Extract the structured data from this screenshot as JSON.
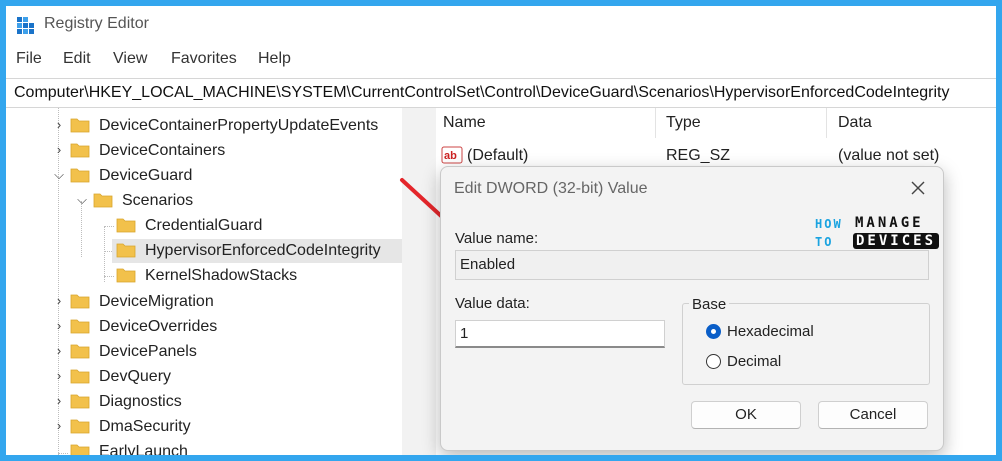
{
  "window": {
    "title": "Registry Editor",
    "accent_color": "#33a6ee"
  },
  "menu": {
    "items": [
      "File",
      "Edit",
      "View",
      "Favorites",
      "Help"
    ]
  },
  "address": {
    "path": "Computer\\HKEY_LOCAL_MACHINE\\SYSTEM\\CurrentControlSet\\Control\\DeviceGuard\\Scenarios\\HypervisorEnforcedCodeIntegrity"
  },
  "tree": {
    "items": [
      {
        "label": "DeviceContainerPropertyUpdateEvents",
        "state": "collapsed"
      },
      {
        "label": "DeviceContainers",
        "state": "collapsed"
      },
      {
        "label": "DeviceGuard",
        "state": "expanded"
      },
      {
        "label": "Scenarios",
        "state": "expanded"
      },
      {
        "label": "CredentialGuard",
        "state": "leaf"
      },
      {
        "label": "HypervisorEnforcedCodeIntegrity",
        "state": "selected"
      },
      {
        "label": "KernelShadowStacks",
        "state": "leaf"
      },
      {
        "label": "DeviceMigration",
        "state": "collapsed"
      },
      {
        "label": "DeviceOverrides",
        "state": "collapsed"
      },
      {
        "label": "DevicePanels",
        "state": "collapsed"
      },
      {
        "label": "DevQuery",
        "state": "collapsed"
      },
      {
        "label": "Diagnostics",
        "state": "collapsed"
      },
      {
        "label": "DmaSecurity",
        "state": "collapsed"
      },
      {
        "label": "EarlyLaunch",
        "state": "leaf"
      }
    ],
    "folder_color": "#f2c14b"
  },
  "list": {
    "columns": [
      "Name",
      "Type",
      "Data"
    ],
    "rows": [
      {
        "name": "(Default)",
        "type": "REG_SZ",
        "data": "(value not set)",
        "icon": "string-value-icon"
      }
    ]
  },
  "dialog": {
    "title": "Edit DWORD (32-bit) Value",
    "value_name_label": "Value name:",
    "value_name": "Enabled",
    "value_data_label": "Value data:",
    "value_data": "1",
    "base_label": "Base",
    "base_options": [
      {
        "label": "Hexadecimal",
        "selected": true
      },
      {
        "label": "Decimal",
        "selected": false
      }
    ],
    "ok_label": "OK",
    "cancel_label": "Cancel"
  },
  "watermark": {
    "line1": "HOW",
    "line2": "TO",
    "brand1": "MANAGE",
    "brand2": "DEVICES"
  },
  "annotation": {
    "arrow_color": "#e4262b"
  }
}
